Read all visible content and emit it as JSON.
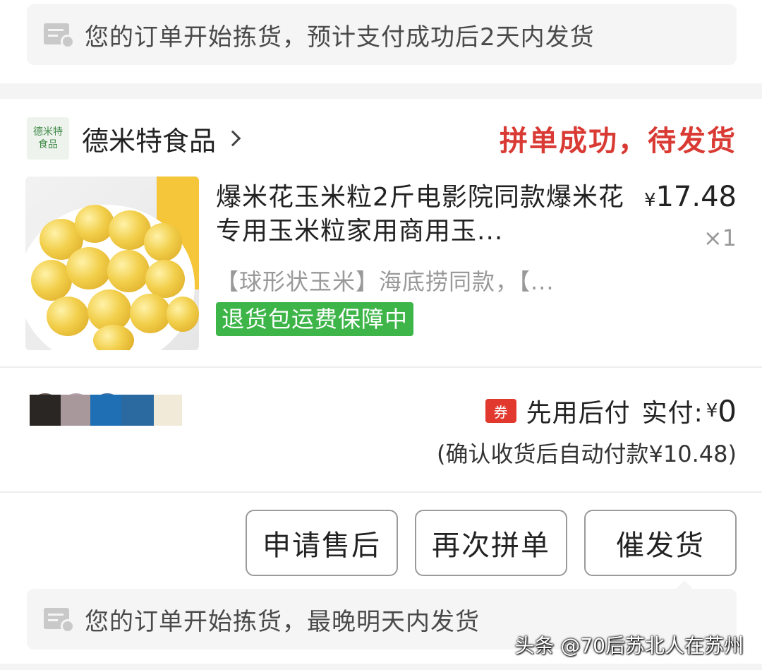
{
  "top_notice": {
    "text": "您的订单开始拣货，预计支付成功后2天内发货"
  },
  "store": {
    "logo_line1": "德米特",
    "logo_line2": "食品",
    "name": "德米特食品",
    "status": "拼单成功，待发货"
  },
  "product": {
    "title": "爆米花玉米粒2斤电影院同款爆米花专用玉米粒家用商用玉...",
    "price_symbol": "¥",
    "price_value": "17.48",
    "quantity": "×1",
    "spec": "【球形状玉米】海底捞同款，【...",
    "guarantee_badge": "退货包运费保障中"
  },
  "payment": {
    "coupon_icon_text": "券",
    "method": "先用后付",
    "paid_label": "实付:",
    "paid_symbol": "¥",
    "paid_amount": "0",
    "auto_pay_note": "(确认收货后自动付款¥10.48)"
  },
  "actions": {
    "after_sale": "申请售后",
    "reorder": "再次拼单",
    "urge_shipping": "催发货"
  },
  "bottom_notice": {
    "text": "您的订单开始拣货，最晚明天内发货"
  },
  "watermark": "头条 @70后苏北人在苏州",
  "colors": {
    "status_red": "#d93a33",
    "badge_green": "#3db548",
    "coupon_red": "#e2392f"
  }
}
